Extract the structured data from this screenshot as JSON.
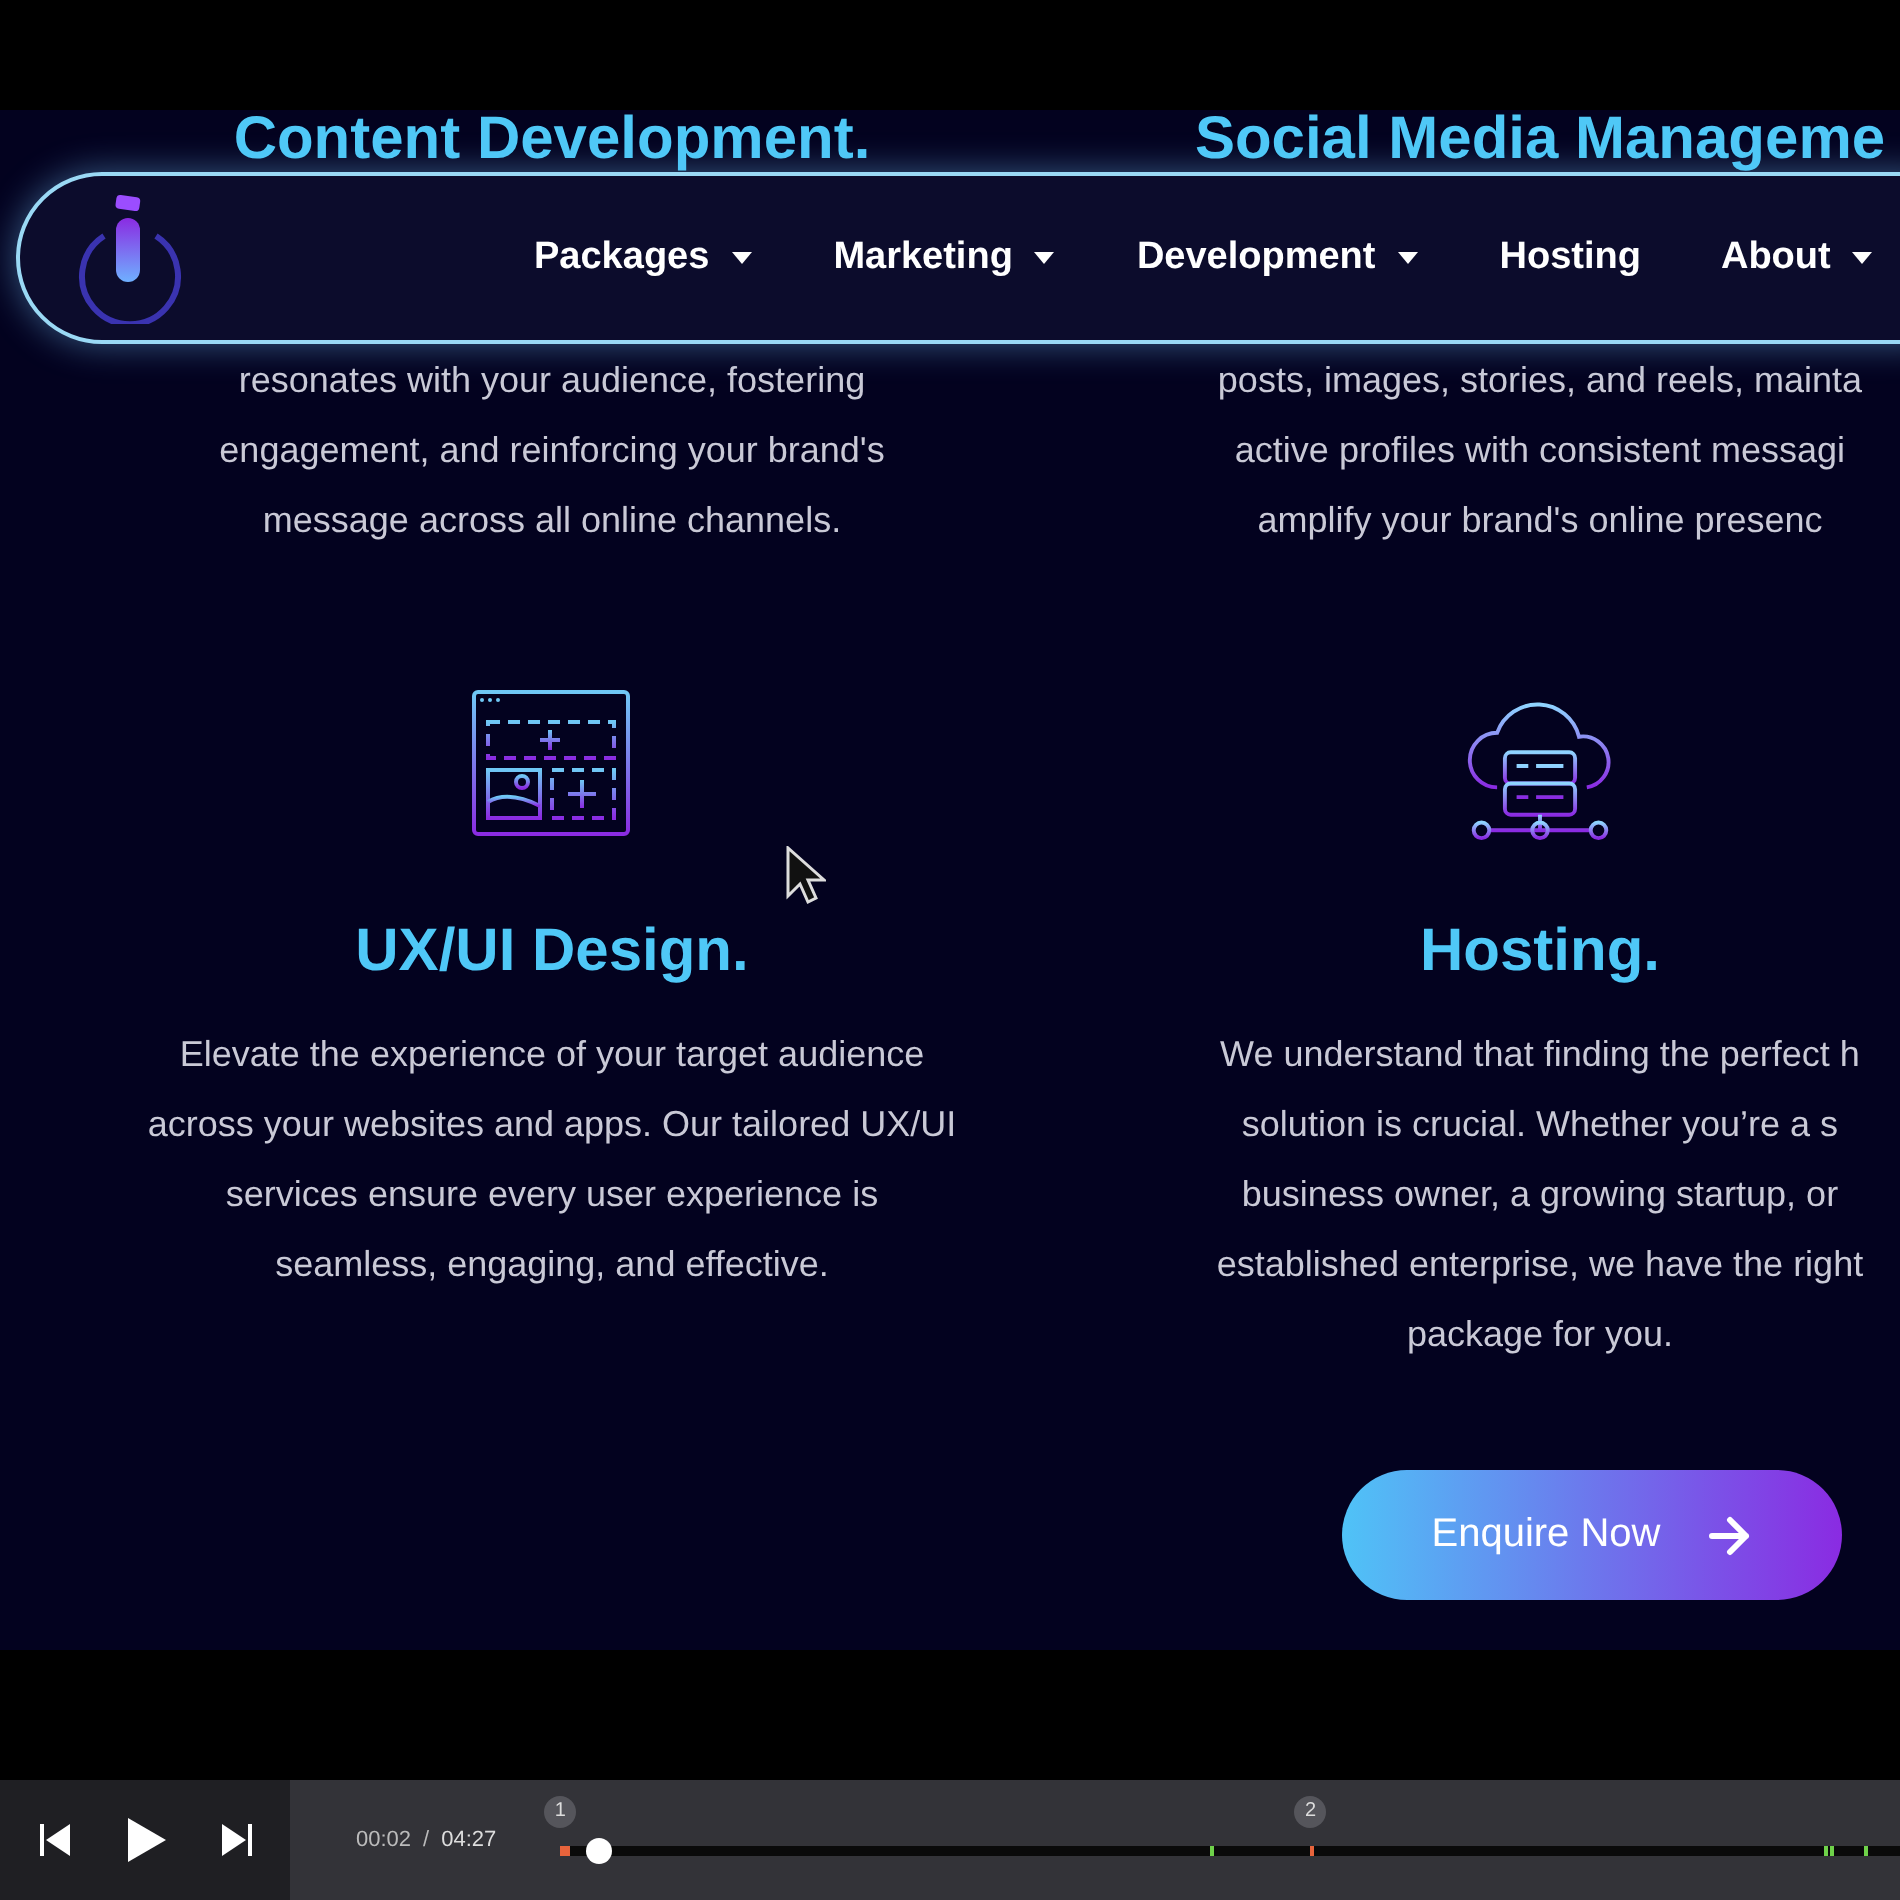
{
  "nav": {
    "items": [
      {
        "label": "Packages",
        "has_dropdown": true
      },
      {
        "label": "Marketing",
        "has_dropdown": true
      },
      {
        "label": "Development",
        "has_dropdown": true
      },
      {
        "label": "Hosting",
        "has_dropdown": false
      },
      {
        "label": "About",
        "has_dropdown": true
      }
    ]
  },
  "services_top": [
    {
      "title": "Content Development.",
      "lines": [
        "resonates with your audience, fostering",
        "engagement, and reinforcing your brand's",
        "message across all online channels."
      ]
    },
    {
      "title": "Social Media Manageme",
      "lines": [
        "posts, images, stories, and reels, mainta",
        "active profiles with consistent messagi",
        "amplify your brand's online presenc"
      ]
    }
  ],
  "services": [
    {
      "kind": "layout",
      "title": "UX/UI Design.",
      "lines": [
        "Elevate the experience of your target audience",
        "across your websites and apps. Our tailored UX/UI",
        "services ensure every user experience is",
        "seamless, engaging, and effective."
      ]
    },
    {
      "kind": "cloud",
      "title": "Hosting.",
      "lines": [
        "We understand that finding the perfect h",
        "solution is crucial. Whether you’re a s",
        "business owner, a growing startup, or",
        "established enterprise, we have the right",
        "package for you."
      ],
      "button": {
        "label": "Enquire Now"
      }
    }
  ],
  "player": {
    "current_time": "00:02",
    "separator": "/",
    "duration": "04:27",
    "level": 0.008,
    "chapters": [
      {
        "label": "1"
      },
      {
        "label": "2"
      }
    ]
  }
}
